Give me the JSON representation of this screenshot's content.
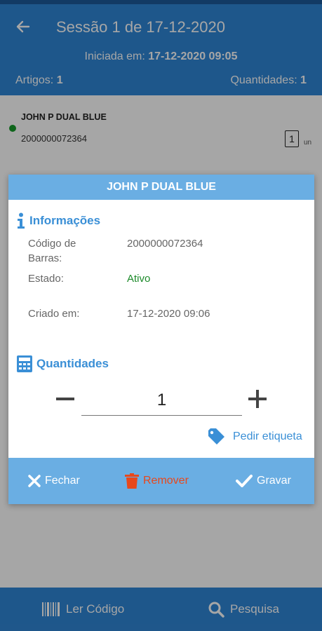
{
  "header": {
    "title": "Sessão 1 de 17-12-2020",
    "started_label": "Iniciada em:",
    "started_value": "17-12-2020 09:05",
    "articles_label": "Artigos:",
    "articles_value": "1",
    "quantities_label": "Quantidades:",
    "quantities_value": "1"
  },
  "list": {
    "items": [
      {
        "name": "JOHN P DUAL BLUE",
        "barcode": "2000000072364",
        "quantity": "1",
        "unit": "un",
        "status_color": "#169b2a"
      }
    ]
  },
  "bottom_bar": {
    "scan_label": "Ler Código",
    "search_label": "Pesquisa"
  },
  "dialog": {
    "title": "JOHN P DUAL BLUE",
    "info_title": "Informações",
    "barcode_label": "Código de Barras:",
    "barcode_value": "2000000072364",
    "state_label": "Estado:",
    "state_value": "Ativo",
    "created_label": "Criado em:",
    "created_value": "17-12-2020 09:06",
    "quantities_title": "Quantidades",
    "quantity_value": "1",
    "request_label": "Pedir etiqueta",
    "close_label": "Fechar",
    "remove_label": "Remover",
    "save_label": "Gravar"
  },
  "colors": {
    "primary": "#2f86d6",
    "dialog_accent": "#6aaee3",
    "active_green": "#1c8a2a",
    "remove_red": "#e8481c"
  }
}
